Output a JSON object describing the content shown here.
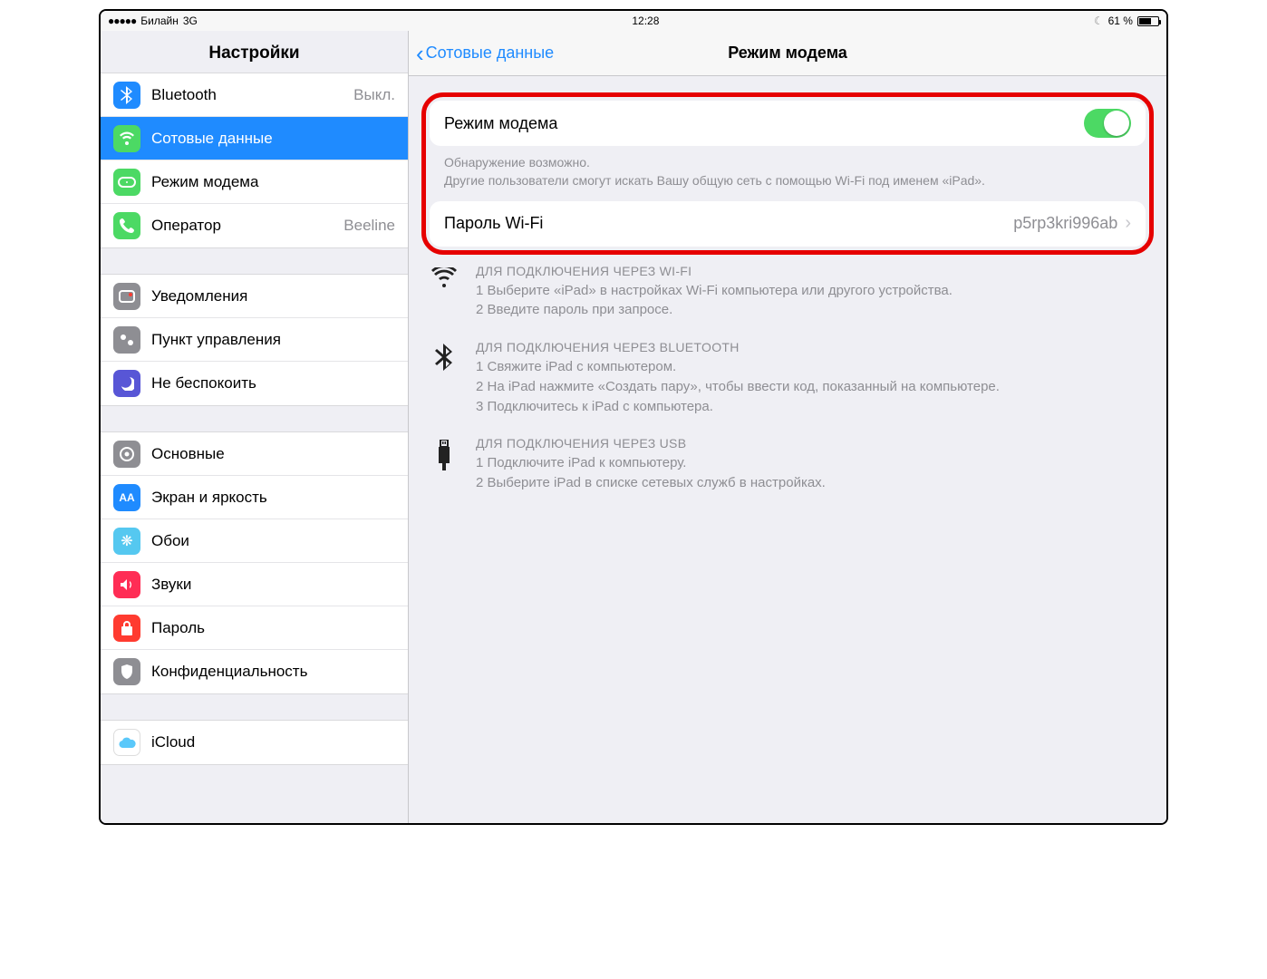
{
  "status": {
    "carrier": "Билайн",
    "network": "3G",
    "time": "12:28",
    "battery_pct": "61 %"
  },
  "sidebar": {
    "title": "Настройки",
    "groups": [
      [
        {
          "label": "Bluetooth",
          "value": "Выкл.",
          "icon": "bluetooth-icon",
          "bg": "#1f8bff"
        },
        {
          "label": "Сотовые данные",
          "value": "",
          "icon": "cellular-icon",
          "bg": "#4cd964",
          "selected": true
        },
        {
          "label": "Режим модема",
          "value": "",
          "icon": "hotspot-icon",
          "bg": "#4cd964"
        },
        {
          "label": "Оператор",
          "value": "Beeline",
          "icon": "phone-icon",
          "bg": "#4cd964"
        }
      ],
      [
        {
          "label": "Уведомления",
          "value": "",
          "icon": "notifications-icon",
          "bg": "#8e8e93"
        },
        {
          "label": "Пункт управления",
          "value": "",
          "icon": "control-center-icon",
          "bg": "#8e8e93"
        },
        {
          "label": "Не беспокоить",
          "value": "",
          "icon": "dnd-icon",
          "bg": "#5856d6"
        }
      ],
      [
        {
          "label": "Основные",
          "value": "",
          "icon": "general-icon",
          "bg": "#8e8e93"
        },
        {
          "label": "Экран и яркость",
          "value": "",
          "icon": "display-icon",
          "bg": "#1f8bff"
        },
        {
          "label": "Обои",
          "value": "",
          "icon": "wallpaper-icon",
          "bg": "#55c8f0"
        },
        {
          "label": "Звуки",
          "value": "",
          "icon": "sounds-icon",
          "bg": "#ff2d55"
        },
        {
          "label": "Пароль",
          "value": "",
          "icon": "passcode-icon",
          "bg": "#ff3b30"
        },
        {
          "label": "Конфиденциальность",
          "value": "",
          "icon": "privacy-icon",
          "bg": "#8e8e93"
        }
      ],
      [
        {
          "label": "iCloud",
          "value": "",
          "icon": "icloud-icon",
          "bg": "#fff"
        }
      ]
    ]
  },
  "main": {
    "back_label": "Сотовые данные",
    "title": "Режим модема",
    "hotspot_label": "Режим модема",
    "caption1": "Обнаружение возможно.",
    "caption2": "Другие пользователи смогут искать Вашу общую сеть с помощью Wi-Fi под именем «iPad».",
    "password_label": "Пароль Wi-Fi",
    "password_value": "p5rp3kri996ab",
    "wifi": {
      "title": "ДЛЯ ПОДКЛЮЧЕНИЯ ЧЕРЕЗ WI-FI",
      "l1": "1 Выберите «iPad» в настройках Wi-Fi компьютера или другого устройства.",
      "l2": "2 Введите пароль при запросе."
    },
    "bt": {
      "title": "ДЛЯ ПОДКЛЮЧЕНИЯ ЧЕРЕЗ BLUETOOTH",
      "l1": "1 Свяжите iPad с компьютером.",
      "l2": "2 На iPad нажмите «Создать пару», чтобы ввести код, показанный на компьютере.",
      "l3": "3 Подключитесь к iPad с компьютера."
    },
    "usb": {
      "title": "ДЛЯ ПОДКЛЮЧЕНИЯ ЧЕРЕЗ USB",
      "l1": "1 Подключите iPad к компьютеру.",
      "l2": "2 Выберите iPad в списке сетевых служб в настройках."
    }
  }
}
